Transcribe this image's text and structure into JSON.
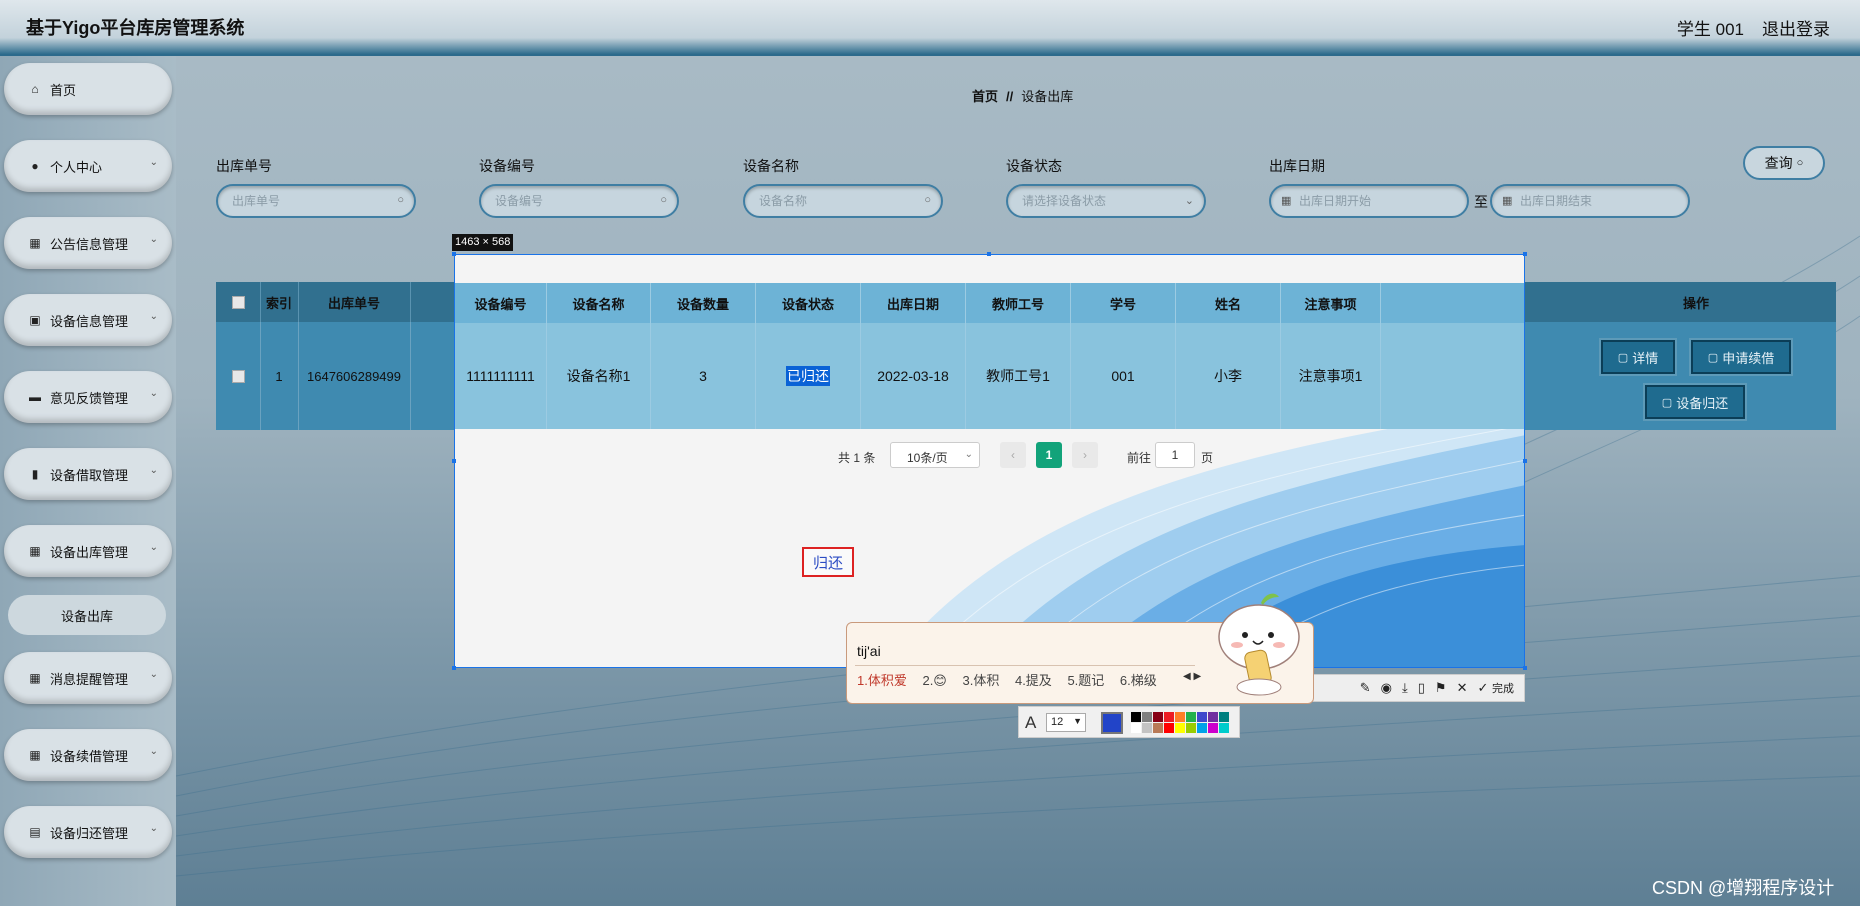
{
  "header": {
    "title": "基于Yigo平台库房管理系统",
    "user": "学生 001",
    "logout": "退出登录"
  },
  "sidebar": {
    "items": [
      {
        "label": "首页",
        "icon": "home-icon"
      },
      {
        "label": "个人中心",
        "icon": "person-icon"
      },
      {
        "label": "公告信息管理",
        "icon": "grid-icon"
      },
      {
        "label": "设备信息管理",
        "icon": "cart-icon"
      },
      {
        "label": "意见反馈管理",
        "icon": "chat-icon"
      },
      {
        "label": "设备借取管理",
        "icon": "book-icon"
      },
      {
        "label": "设备出库管理",
        "icon": "grid-icon"
      },
      {
        "label": "消息提醒管理",
        "icon": "grid-icon"
      },
      {
        "label": "设备续借管理",
        "icon": "grid-icon"
      },
      {
        "label": "设备归还管理",
        "icon": "bag-icon"
      }
    ],
    "submenu": "设备出库"
  },
  "breadcrumb": {
    "home": "首页",
    "sep": "//",
    "current": "设备出库"
  },
  "filters": {
    "order_no": {
      "label": "出库单号",
      "placeholder": "出库单号"
    },
    "device_no": {
      "label": "设备编号",
      "placeholder": "设备编号"
    },
    "device_name": {
      "label": "设备名称",
      "placeholder": "设备名称"
    },
    "device_status": {
      "label": "设备状态",
      "placeholder": "请选择设备状态"
    },
    "date": {
      "label": "出库日期",
      "start_placeholder": "出库日期开始",
      "to": "至",
      "end_placeholder": "出库日期结束"
    },
    "search": "查询"
  },
  "table": {
    "headers": [
      "索引",
      "出库单号",
      "设备编号",
      "设备名称",
      "设备数量",
      "设备状态",
      "出库日期",
      "教师工号",
      "学号",
      "姓名",
      "注意事项",
      "操作"
    ],
    "row": {
      "index": "1",
      "order_no": "1647606289499",
      "device_no": "1111111111",
      "device_name": "设备名称1",
      "quantity": "3",
      "status": "已归还",
      "date": "2022-03-18",
      "teacher_no": "教师工号1",
      "student_no": "001",
      "name": "小李",
      "notes": "注意事项1"
    },
    "actions": {
      "detail": "详情",
      "renew": "申请续借",
      "return": "设备归还"
    }
  },
  "pagination": {
    "total": "共 1 条",
    "page_size": "10条/页",
    "current": "1",
    "goto": "前往",
    "goto_value": "1",
    "page": "页"
  },
  "screenshot": {
    "size": "1463 × 568",
    "annotation_text": "归还",
    "toolbar": {
      "done": "完成"
    },
    "font_size": "12",
    "current_color": "#2244c8",
    "palette": [
      "#000000",
      "#7f7f7f",
      "#880015",
      "#ed1c24",
      "#ff7f27",
      "#22b14c",
      "#3f48cc",
      "#7030a0",
      "#008080",
      "#ffffff",
      "#c3c3c3",
      "#b97a57",
      "#ff0000",
      "#ffff00",
      "#99cc00",
      "#00a2e8",
      "#cc00cc",
      "#00cccc"
    ]
  },
  "ime": {
    "input": "tij'ai",
    "candidates": [
      "1.体积爱",
      "2.😊",
      "3.体积",
      "4.提及",
      "5.题记",
      "6.梯级"
    ]
  },
  "watermark": "CSDN @增翔程序设计"
}
